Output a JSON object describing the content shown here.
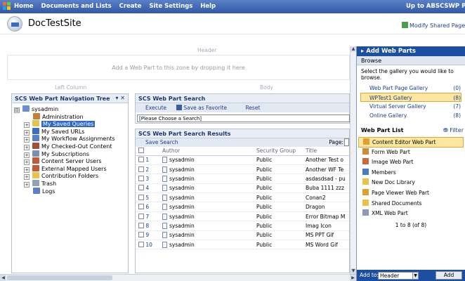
{
  "topbar": {
    "nav": [
      "Home",
      "Documents and Lists",
      "Create",
      "Site Settings",
      "Help"
    ],
    "right_link": "Up to ABSCSWP Porta"
  },
  "site": {
    "title": "DocTestSite",
    "modify_link": "Modify Shared Page"
  },
  "zones": {
    "header_label": "Header",
    "header_hint": "Add a Web Part to this zone by dropping it here",
    "left_label": "Left Column",
    "body_label": "Body"
  },
  "navtree": {
    "title": "SCS Web Part Navigation Tree",
    "controls": "▾ ✕",
    "items": [
      {
        "label": "sysadmin",
        "level": 0,
        "exp": "⊟",
        "icon_color": "#6b8fd0"
      },
      {
        "label": "Administration",
        "level": 1,
        "exp": "",
        "icon_color": "#c0803a"
      },
      {
        "label": "My Saved Queries",
        "level": 1,
        "exp": "+",
        "icon_color": "#e8c34a",
        "selected": true
      },
      {
        "label": "My Saved URLs",
        "level": 1,
        "exp": "+",
        "icon_color": "#3a6fc0"
      },
      {
        "label": "My Workflow Assignments",
        "level": 1,
        "exp": "+",
        "icon_color": "#5d7fc4"
      },
      {
        "label": "My Checked-Out Content",
        "level": 1,
        "exp": "+",
        "icon_color": "#a44d3a"
      },
      {
        "label": "My Subscriptions",
        "level": 1,
        "exp": "+",
        "icon_color": "#7d8fb0"
      },
      {
        "label": "Content Server Users",
        "level": 1,
        "exp": "+",
        "icon_color": "#c05a3a"
      },
      {
        "label": "External Mapped Users",
        "level": 1,
        "exp": "+",
        "icon_color": "#c05a3a"
      },
      {
        "label": "Contribution Folders",
        "level": 1,
        "exp": "+",
        "icon_color": "#e8c34a"
      },
      {
        "label": "Trash",
        "level": 1,
        "exp": "+",
        "icon_color": "#8fa0b8"
      },
      {
        "label": "Logs",
        "level": 1,
        "exp": "",
        "icon_color": "#5d7fc4"
      }
    ]
  },
  "search": {
    "title": "SCS Web Part Search",
    "execute": "Execute",
    "save_favorite": "Save as Favorite",
    "reset": "Reset",
    "select_value": "[Please Choose a Search]"
  },
  "results": {
    "title": "SCS Web Part Search Results",
    "save_search": "Save Search",
    "page_label": "Page:",
    "columns": [
      "Author",
      "Security Group",
      "Title"
    ],
    "rows": [
      {
        "n": "1",
        "author": "sysadmin",
        "group": "Public",
        "title": "Another Test o"
      },
      {
        "n": "2",
        "author": "sysadmin",
        "group": "Public",
        "title": "Another WF Te"
      },
      {
        "n": "3",
        "author": "sysadmin",
        "group": "Public",
        "title": "asdasdsad - pu"
      },
      {
        "n": "4",
        "author": "sysadmin",
        "group": "Public",
        "title": "Buba 1111 zzz"
      },
      {
        "n": "5",
        "author": "sysadmin",
        "group": "Public",
        "title": "Conan2"
      },
      {
        "n": "6",
        "author": "sysadmin",
        "group": "Public",
        "title": "Dragon"
      },
      {
        "n": "7",
        "author": "sysadmin",
        "group": "Public",
        "title": "Error Bitmap M"
      },
      {
        "n": "8",
        "author": "sysadmin",
        "group": "Public",
        "title": "Imag Icon"
      },
      {
        "n": "9",
        "author": "sysadmin",
        "group": "Public",
        "title": "MS PPT Gif"
      },
      {
        "n": "10",
        "author": "sysadmin",
        "group": "Public",
        "title": "MS Word Gif"
      }
    ]
  },
  "pane": {
    "title": "Add Web Parts",
    "browse": "Browse",
    "intro": "Select the gallery you would like to browse.",
    "galleries": [
      {
        "name": "Web Part Page Gallery",
        "count": "(0)"
      },
      {
        "name": "WPTest1 Gallery",
        "count": "(8)",
        "selected": true
      },
      {
        "name": "Virtual Server Gallery",
        "count": "(7)"
      },
      {
        "name": "Online Gallery",
        "count": "(8)"
      }
    ],
    "list_title": "Web Part List",
    "filter": "Filter",
    "parts": [
      {
        "name": "Content Editor Web Part",
        "color": "#e0a030",
        "selected": true
      },
      {
        "name": "Form Web Part",
        "color": "#d08a3a"
      },
      {
        "name": "Image Web Part",
        "color": "#c86a3a"
      },
      {
        "name": "Members",
        "color": "#4a7ac0"
      },
      {
        "name": "New Doc Library",
        "color": "#e8c34a"
      },
      {
        "name": "Page Viewer Web Part",
        "color": "#e0a030"
      },
      {
        "name": "Shared Documents",
        "color": "#e8c34a"
      },
      {
        "name": "XML Web Part",
        "color": "#8a9ab8"
      }
    ],
    "paging": "1 to 8 (of 8)",
    "add_to_label": "Add to:",
    "add_to_value": "Header",
    "add_button": "Add"
  }
}
